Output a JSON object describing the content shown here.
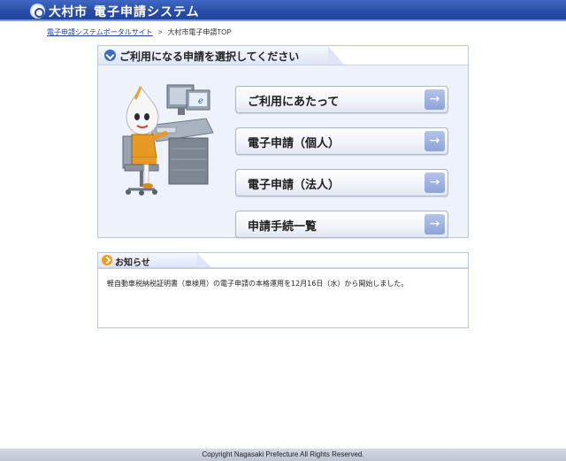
{
  "header": {
    "city": "大村市",
    "system": "電子申請システム"
  },
  "breadcrumb": {
    "portal_link": "電子申請システムポータルサイト",
    "separator": ">",
    "current": "大村市電子申請TOP"
  },
  "select_panel": {
    "title": "ご利用になる申請を選択してください",
    "buttons": [
      {
        "label": "ご利用にあたって"
      },
      {
        "label": "電子申請（個人）"
      },
      {
        "label": "電子申請（法人）"
      },
      {
        "label": "申請手続一覧"
      }
    ],
    "arrow_glyph": "→"
  },
  "notice_panel": {
    "title": "お知らせ",
    "text": "軽自動車税納税証明書（車検用）の電子申請の本格運用を12月16日（水）から開始しました。"
  },
  "footer": {
    "copyright": "Copyright Nagasaki Prefecture All Rights Reserved."
  },
  "colors": {
    "header_blue": "#2a4ea8",
    "panel_border": "#b9c8e6",
    "arrow_blue": "#8ea4d8",
    "notice_orange": "#f09a22"
  }
}
